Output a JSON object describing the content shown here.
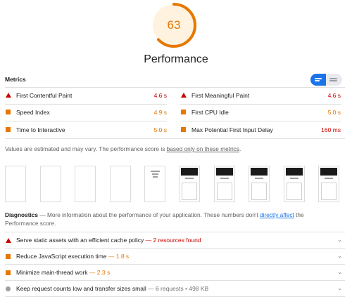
{
  "score": {
    "value": "63",
    "fraction": 0.63,
    "color": "#e67700",
    "title": "Performance"
  },
  "metrics": {
    "label": "Metrics",
    "view_toggle": {
      "icons": [
        "list-view-icon",
        "detail-view-icon"
      ],
      "active": "list-view-icon"
    },
    "items": [
      {
        "name": "First Contentful Paint",
        "value": "4.6 s",
        "status": "fail"
      },
      {
        "name": "First Meaningful Paint",
        "value": "4.6 s",
        "status": "fail"
      },
      {
        "name": "Speed Index",
        "value": "4.9 s",
        "status": "average"
      },
      {
        "name": "First CPU Idle",
        "value": "5.0 s",
        "status": "average"
      },
      {
        "name": "Time to Interactive",
        "value": "5.0 s",
        "status": "average"
      },
      {
        "name": "Max Potential First Input Delay",
        "value": "160 ms",
        "status": "fail"
      }
    ]
  },
  "note": {
    "text": "Values are estimated and may vary. The performance score is ",
    "link": "based only on these metrics",
    "end": "."
  },
  "filmstrip": {
    "frames": [
      "blank",
      "blank",
      "blank",
      "blank",
      "text",
      "page",
      "page",
      "page",
      "page",
      "page"
    ]
  },
  "diagnostics": {
    "title": "Diagnostics",
    "desc_before": " — More information about the performance of your application. These numbers don't ",
    "link": "directly affect",
    "desc_after": " the Performance score.",
    "items": [
      {
        "title": "Serve static assets with an efficient cache policy",
        "display": " — 2 resources found",
        "status": "fail"
      },
      {
        "title": "Reduce JavaScript execution time",
        "display": " — 1.8 s",
        "status": "average"
      },
      {
        "title": "Minimize main-thread work",
        "display": " — 2.3 s",
        "status": "average"
      },
      {
        "title": "Keep request counts low and transfer sizes small",
        "display": " — 6 requests • 498 KB",
        "status": "info"
      }
    ]
  },
  "colors": {
    "fail": "#cc0000",
    "average": "#e67700",
    "info": "#9e9e9e",
    "accent": "#1a73e8"
  }
}
